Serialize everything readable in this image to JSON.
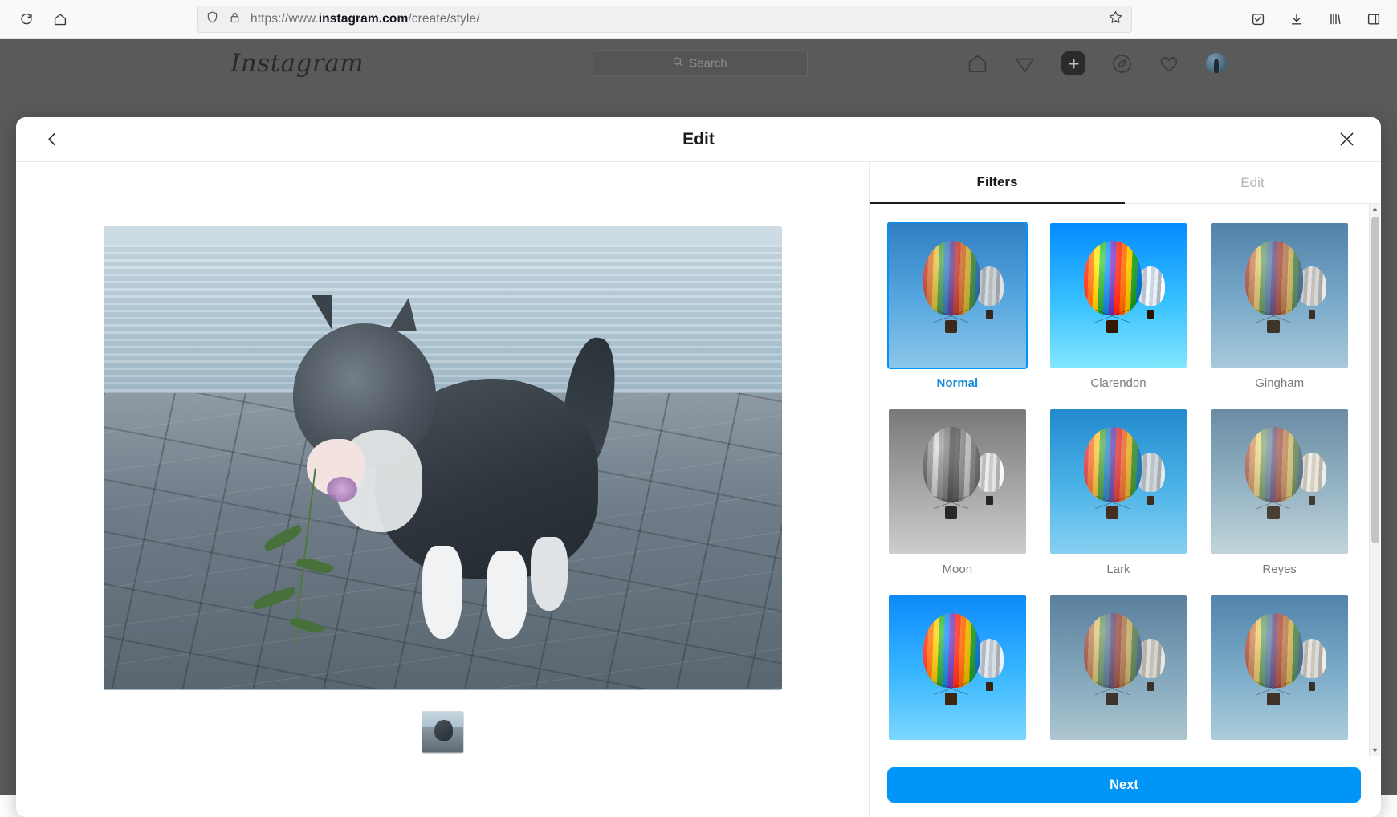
{
  "browser": {
    "url_prefix": "https://www.",
    "url_domain": "instagram.com",
    "url_path": "/create/style/",
    "reload_icon": "reload-icon",
    "home_icon": "home-icon",
    "shield_icon": "shield-icon",
    "lock_icon": "lock-icon",
    "bookmark_icon": "star-bookmark-icon",
    "pocket_icon": "pocket-icon",
    "download_icon": "download-icon",
    "library_icon": "library-icon",
    "sidebar_icon": "sidebar-icon"
  },
  "instagram": {
    "logo": "Instagram",
    "search_placeholder": "Search",
    "nav": [
      {
        "name": "home-icon",
        "label": "Home",
        "active": false
      },
      {
        "name": "messenger-icon",
        "label": "Messages",
        "active": false
      },
      {
        "name": "new-post-icon",
        "label": "New post",
        "active": true
      },
      {
        "name": "explore-icon",
        "label": "Explore",
        "active": false
      },
      {
        "name": "heart-icon",
        "label": "Notifications",
        "active": false
      },
      {
        "name": "avatar",
        "label": "Profile",
        "active": false
      }
    ]
  },
  "modal": {
    "title": "Edit",
    "back_label": "Back",
    "close_label": "Close",
    "tabs": [
      {
        "label": "Filters",
        "active": true
      },
      {
        "label": "Edit",
        "active": false
      }
    ],
    "next_label": "Next",
    "selected_filter": "Normal",
    "filters": [
      {
        "label": "Normal",
        "style": "f-normal",
        "selected": true
      },
      {
        "label": "Clarendon",
        "style": "f-clarendon",
        "selected": false
      },
      {
        "label": "Gingham",
        "style": "f-gingham",
        "selected": false
      },
      {
        "label": "Moon",
        "style": "f-moon",
        "selected": false
      },
      {
        "label": "Lark",
        "style": "f-lark",
        "selected": false
      },
      {
        "label": "Reyes",
        "style": "f-reyes",
        "selected": false
      },
      {
        "label": "",
        "style": "f-juno",
        "selected": false
      },
      {
        "label": "",
        "style": "f-slumber",
        "selected": false
      },
      {
        "label": "",
        "style": "f-crema",
        "selected": false
      }
    ],
    "media_thumbnails": [
      {
        "alt": "Kitten on cobblestones"
      }
    ]
  },
  "colors": {
    "accent": "#0095f6",
    "selected_label": "#1a8cd8",
    "overlay": "#5a5a5a",
    "text_primary": "#1c1c1c",
    "text_muted": "#7a7a7a"
  }
}
